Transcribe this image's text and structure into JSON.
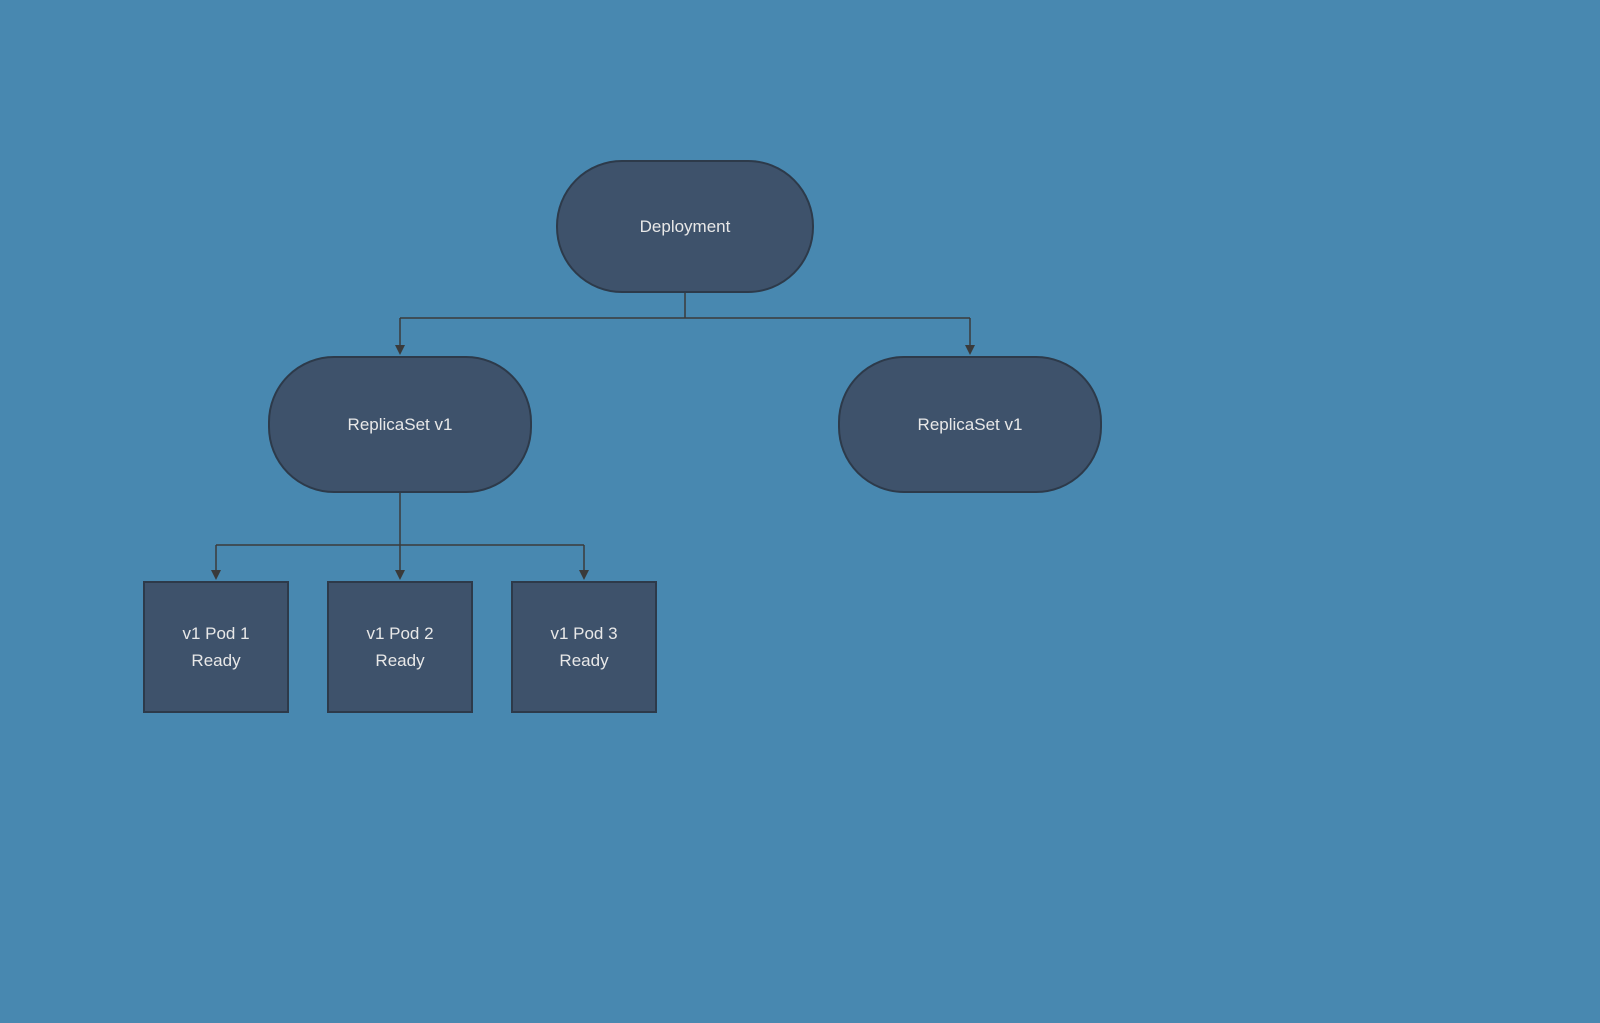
{
  "nodes": {
    "deployment": {
      "label": "Deployment"
    },
    "replicaset_left": {
      "label": "ReplicaSet v1"
    },
    "replicaset_right": {
      "label": "ReplicaSet v1"
    },
    "pod1": {
      "title": "v1 Pod 1",
      "status": "Ready"
    },
    "pod2": {
      "title": "v1 Pod 2",
      "status": "Ready"
    },
    "pod3": {
      "title": "v1 Pod 3",
      "status": "Ready"
    }
  }
}
